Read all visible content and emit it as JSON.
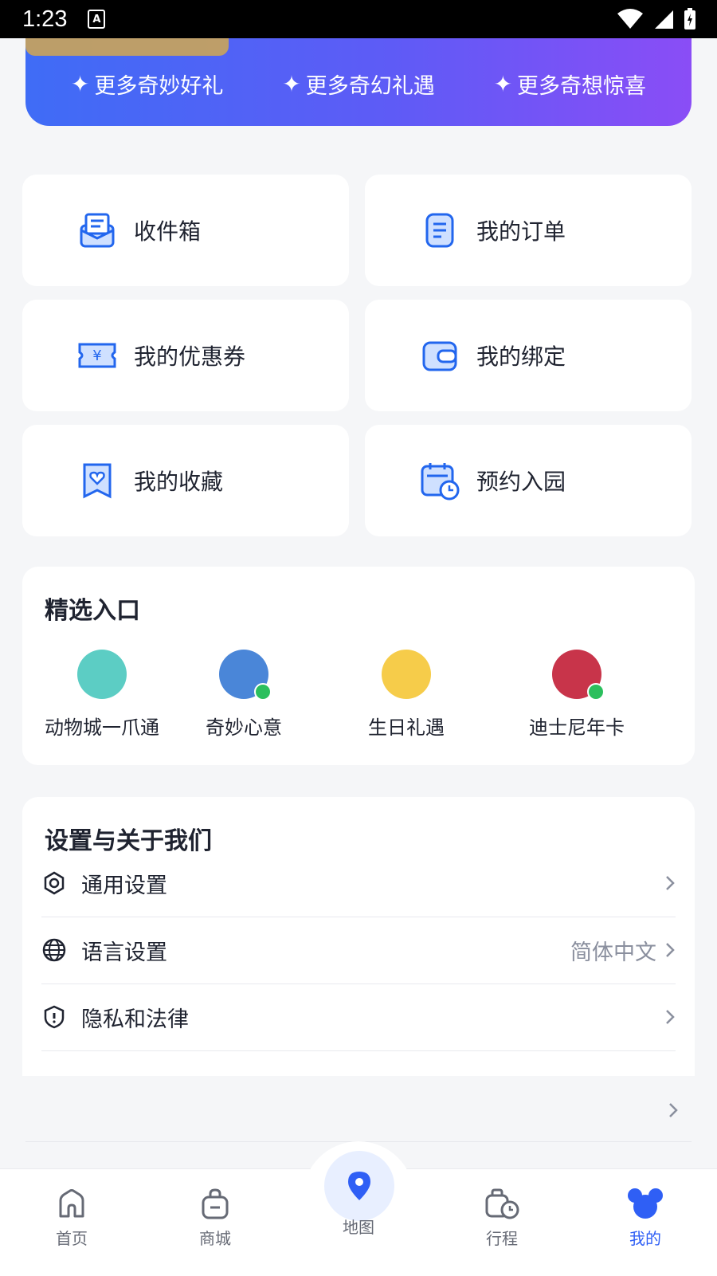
{
  "status_bar": {
    "time": "1:23",
    "notification_icon_letter": "A"
  },
  "banner": {
    "items": [
      {
        "label": "更多奇妙好礼"
      },
      {
        "label": "更多奇幻礼遇"
      },
      {
        "label": "更多奇想惊喜"
      }
    ]
  },
  "tiles": [
    {
      "label": "收件箱",
      "icon": "inbox-icon"
    },
    {
      "label": "我的订单",
      "icon": "order-icon"
    },
    {
      "label": "我的优惠券",
      "icon": "coupon-icon"
    },
    {
      "label": "我的绑定",
      "icon": "wallet-icon"
    },
    {
      "label": "我的收藏",
      "icon": "favorite-icon"
    },
    {
      "label": "预约入园",
      "icon": "calendar-clock-icon"
    }
  ],
  "featured": {
    "title": "精选入口",
    "items": [
      {
        "label": "动物城一爪通"
      },
      {
        "label": "奇妙心意"
      },
      {
        "label": "生日礼遇"
      },
      {
        "label": "迪士尼年卡"
      }
    ]
  },
  "settings": {
    "title": "设置与关于我们",
    "rows": [
      {
        "label": "通用设置",
        "value": ""
      },
      {
        "label": "语言设置",
        "value": "简体中文"
      },
      {
        "label": "隐私和法律",
        "value": ""
      }
    ]
  },
  "tabbar": {
    "tabs": [
      {
        "label": "首页"
      },
      {
        "label": "商城"
      },
      {
        "label": "地图"
      },
      {
        "label": "行程"
      },
      {
        "label": "我的"
      }
    ],
    "active": "我的"
  },
  "colors": {
    "accent": "#2f5ff5",
    "banner_start": "#3f6cf6",
    "banner_end": "#8a4df6",
    "icon_blue": "#2266ee"
  }
}
